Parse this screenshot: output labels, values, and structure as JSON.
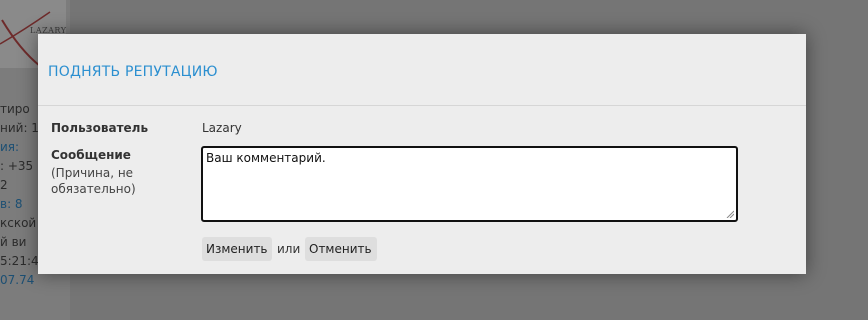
{
  "background": {
    "avatar_caption": "LAZARY",
    "lines": [
      "тиро",
      "ний: 1",
      "ия:",
      ": +35",
      "2",
      "в: 8",
      "кской",
      "й ви",
      "5:21:4",
      "07.74"
    ]
  },
  "dialog": {
    "title": "ПОДНЯТЬ РЕПУТАЦИЮ",
    "user_label": "Пользователь",
    "user_value": "Lazary",
    "message_label": "Сообщение",
    "message_hint": "(Причина, не обязательно)",
    "comment_value": "Ваш комментарий.",
    "change_button": "Изменить",
    "or_text": "или",
    "cancel_button": "Отменить"
  },
  "colors": {
    "title": "#2b8fd0",
    "overlay": "#757575",
    "dialog_bg": "#ededed"
  }
}
